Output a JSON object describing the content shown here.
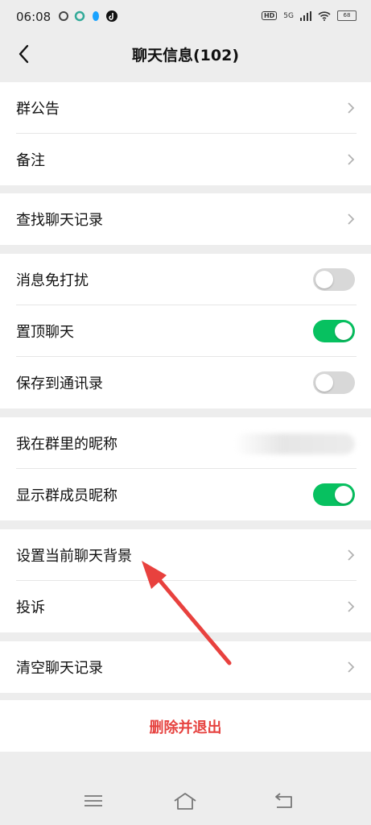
{
  "status_bar": {
    "time": "06:08",
    "hd": "HD",
    "network": "5G",
    "battery": "68"
  },
  "header": {
    "title": "聊天信息(102)"
  },
  "rows": {
    "announcement": "群公告",
    "remark": "备注",
    "search_history": "查找聊天记录",
    "mute": "消息免打扰",
    "sticky": "置顶聊天",
    "save_contacts": "保存到通讯录",
    "my_nickname": "我在群里的昵称",
    "show_nicknames": "显示群成员昵称",
    "background": "设置当前聊天背景",
    "complaint": "投诉",
    "clear_history": "清空聊天记录"
  },
  "toggles": {
    "mute": false,
    "sticky": true,
    "save_contacts": false,
    "show_nicknames": true
  },
  "delete_button": "删除并退出",
  "colors": {
    "accent_green": "#07c160",
    "danger_red": "#e64340",
    "annotation_arrow": "#e8413e"
  }
}
